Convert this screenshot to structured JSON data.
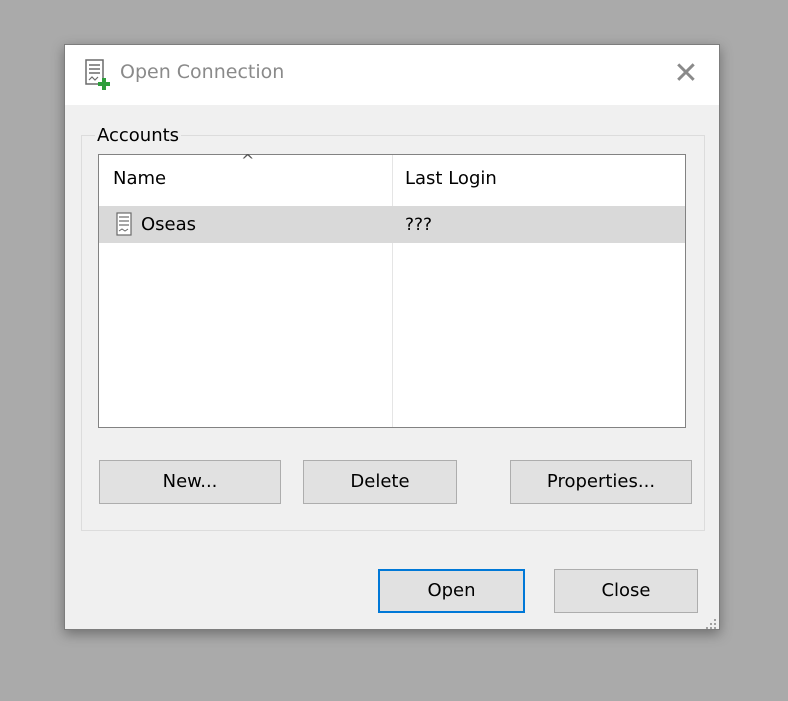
{
  "window": {
    "title": "Open Connection",
    "close_glyph": "✕"
  },
  "accounts": {
    "group_label": "Accounts",
    "columns": [
      "Name",
      "Last Login"
    ],
    "sort_indicator": "^",
    "rows": [
      {
        "name": "Oseas",
        "last_login": "???"
      }
    ]
  },
  "buttons": {
    "new": "New...",
    "delete": "Delete",
    "properties": "Properties...",
    "open": "Open",
    "close": "Close"
  },
  "icons": {
    "title_icon": "new-connection-icon",
    "row_icon": "server-icon"
  },
  "colors": {
    "focus_accent": "#0078d7",
    "selected_row": "#d9d9d9"
  }
}
